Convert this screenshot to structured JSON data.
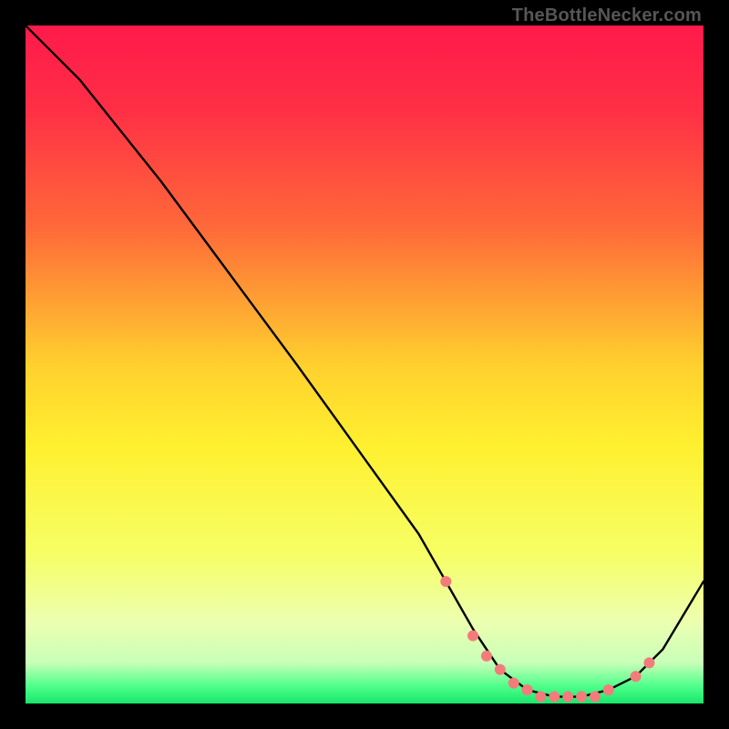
{
  "watermark": "TheBottleNecker.com",
  "gradient": {
    "stops": [
      {
        "offset": 0.0,
        "color": "#ff1a4a"
      },
      {
        "offset": 0.12,
        "color": "#ff2e46"
      },
      {
        "offset": 0.3,
        "color": "#ff6a39"
      },
      {
        "offset": 0.5,
        "color": "#ffd02e"
      },
      {
        "offset": 0.62,
        "color": "#fff02f"
      },
      {
        "offset": 0.78,
        "color": "#f6ff66"
      },
      {
        "offset": 0.88,
        "color": "#ecffb0"
      },
      {
        "offset": 0.94,
        "color": "#c8ffb8"
      },
      {
        "offset": 0.975,
        "color": "#4dff8a"
      },
      {
        "offset": 1.0,
        "color": "#18e66b"
      }
    ]
  },
  "chart_data": {
    "type": "line",
    "title": "",
    "xlabel": "",
    "ylabel": "",
    "xlim": [
      0,
      100
    ],
    "ylim": [
      0,
      100
    ],
    "series": [
      {
        "name": "curve",
        "x": [
          0,
          3,
          8,
          20,
          40,
          58,
          62,
          66,
          70,
          74,
          78,
          82,
          86,
          90,
          94,
          100
        ],
        "y": [
          100,
          97,
          92,
          77,
          50,
          25,
          18,
          11,
          5,
          2,
          1,
          1,
          2,
          4,
          8,
          18
        ]
      }
    ],
    "markers": {
      "name": "dots",
      "x": [
        62,
        66,
        68,
        70,
        72,
        74,
        76,
        78,
        80,
        82,
        84,
        86,
        90,
        92
      ],
      "y": [
        18,
        10,
        7,
        5,
        3,
        2,
        1,
        1,
        1,
        1,
        1,
        2,
        4,
        6
      ],
      "r": 6,
      "color": "#f47b7b"
    }
  }
}
